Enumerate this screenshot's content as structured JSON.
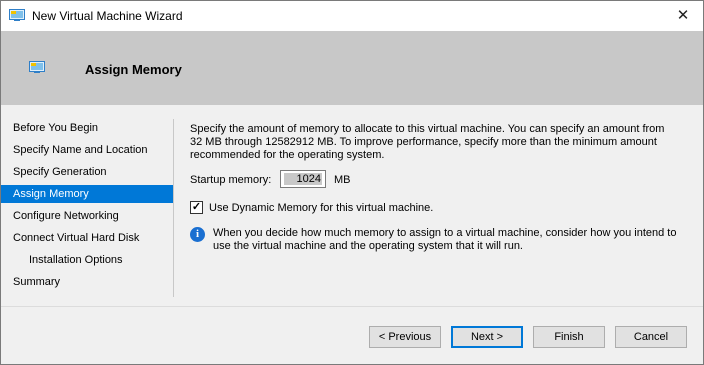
{
  "window": {
    "title": "New Virtual Machine Wizard",
    "close_glyph": "✕"
  },
  "header": {
    "title": "Assign Memory"
  },
  "nav": {
    "items": [
      {
        "label": "Before You Begin"
      },
      {
        "label": "Specify Name and Location"
      },
      {
        "label": "Specify Generation"
      },
      {
        "label": "Assign Memory"
      },
      {
        "label": "Configure Networking"
      },
      {
        "label": "Connect Virtual Hard Disk"
      },
      {
        "label": "Installation Options"
      },
      {
        "label": "Summary"
      }
    ],
    "active_index": 3
  },
  "content": {
    "description": "Specify the amount of memory to allocate to this virtual machine. You can specify an amount from 32 MB through 12582912 MB. To improve performance, specify more than the minimum amount recommended for the operating system.",
    "startup_memory_label": "Startup memory:",
    "startup_memory_value": "1024",
    "startup_memory_unit": "MB",
    "dynamic_memory_label": "Use Dynamic Memory for this virtual machine.",
    "dynamic_memory_checked": true,
    "info_text": "When you decide how much memory to assign to a virtual machine, consider how you intend to use the virtual machine and the operating system that it will run."
  },
  "buttons": {
    "previous": "< Previous",
    "next": "Next >",
    "finish": "Finish",
    "cancel": "Cancel"
  },
  "colors": {
    "accent": "#0078d7",
    "header_bg": "#c8c8c8",
    "info": "#1a6fd1"
  },
  "icons": {
    "app": "vm-icon",
    "header": "vm-icon",
    "info": "info-icon",
    "close": "close-icon"
  }
}
